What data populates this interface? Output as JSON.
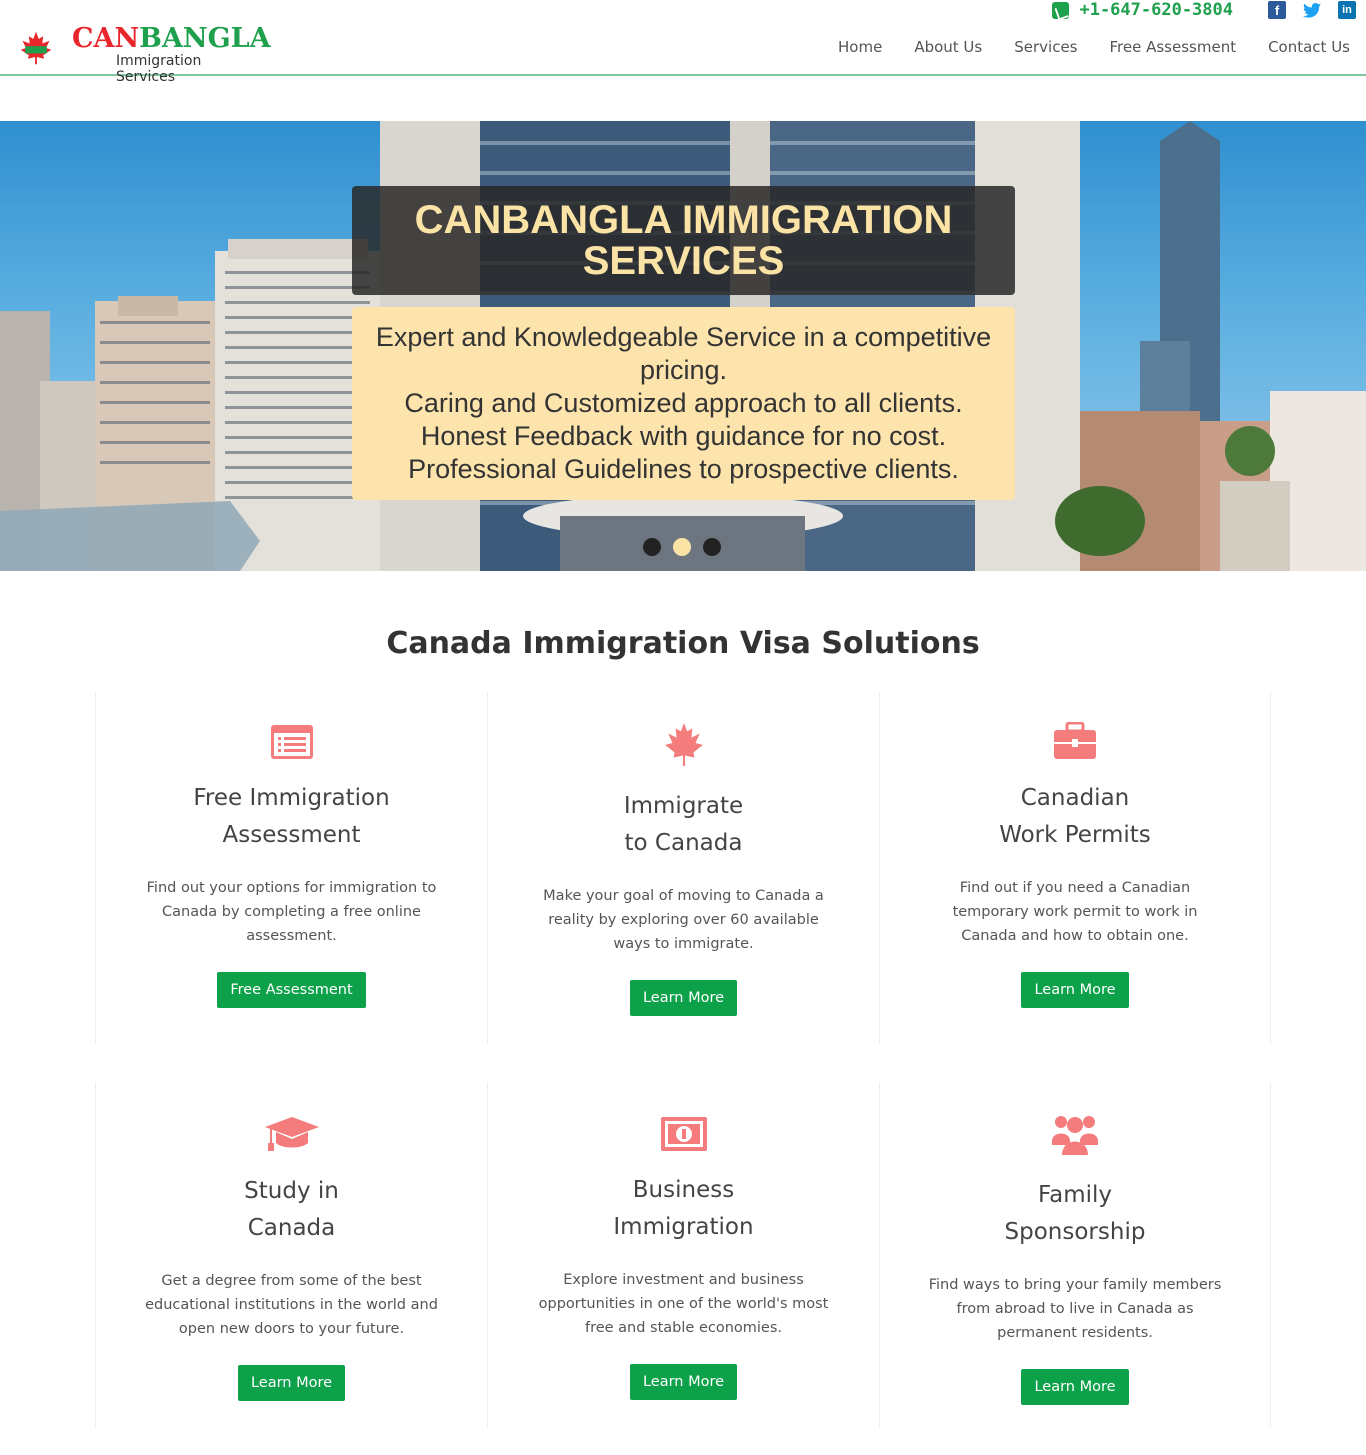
{
  "header": {
    "logo_can": "CAN",
    "logo_bangla": "BANGLA",
    "logo_sub": "Immigration Services",
    "phone": "+1-647-620-3804",
    "social": {
      "facebook": "f",
      "twitter": "🐦",
      "linkedin": "in"
    },
    "nav": [
      "Home",
      "About Us",
      "Services",
      "Free Assessment",
      "Contact Us"
    ]
  },
  "hero": {
    "title": "CANBANGLA IMMIGRATION SERVICES",
    "lines": [
      "Expert and Knowledgeable Service in a competitive pricing.",
      "Caring and Customized approach to all clients.",
      "Honest Feedback with guidance for no cost.",
      "Professional Guidelines to prospective clients."
    ],
    "slides": 3,
    "active_slide": 2
  },
  "section": {
    "title": "Canada Immigration Visa Solutions"
  },
  "cards": [
    {
      "icon": "list-icon",
      "title_1": "Free Immigration",
      "title_2": "Assessment",
      "desc": "Find out your options for immigration to Canada by completing a free online assessment.",
      "button": "Free Assessment"
    },
    {
      "icon": "maple-leaf-icon",
      "title_1": "Immigrate",
      "title_2": "to Canada",
      "desc": "Make your goal of moving to Canada a reality by exploring over 60 available ways to immigrate.",
      "button": "Learn More"
    },
    {
      "icon": "briefcase-icon",
      "title_1": "Canadian",
      "title_2": "Work Permits",
      "desc": "Find out if you need a Canadian temporary work permit to work in Canada and how to obtain one.",
      "button": "Learn More"
    },
    {
      "icon": "graduation-cap-icon",
      "title_1": "Study in",
      "title_2": "Canada",
      "desc": "Get a degree from some of the best educational institutions in the world and open new doors to your future.",
      "button": "Learn More"
    },
    {
      "icon": "money-icon",
      "title_1": "Business",
      "title_2": "Immigration",
      "desc": "Explore investment and business opportunities in one of the world's most free and stable economies.",
      "button": "Learn More"
    },
    {
      "icon": "users-icon",
      "title_1": "Family",
      "title_2": "Sponsorship",
      "desc": "Find ways to bring your family members from abroad to live in Canada as permanent residents.",
      "button": "Learn More"
    }
  ],
  "colors": {
    "accent_green": "#0da24a",
    "icon_red": "#f47c7c",
    "hero_title": "#fbe3a6",
    "hero_box": "#fde4ad"
  }
}
